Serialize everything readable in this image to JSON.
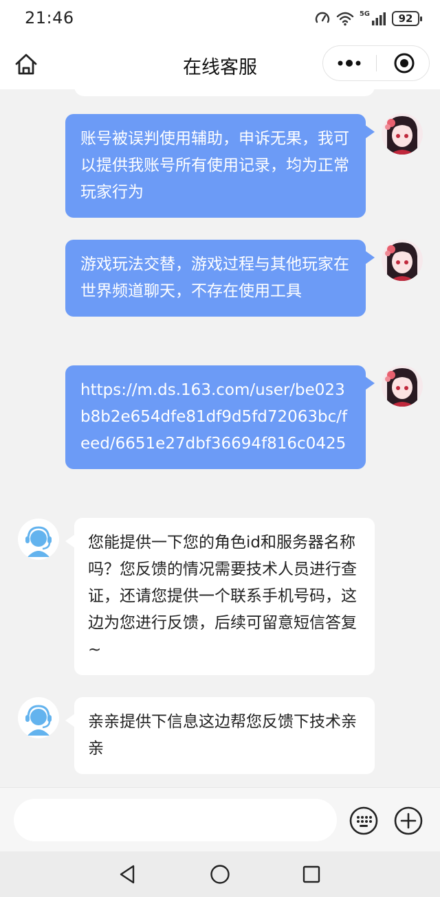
{
  "status_bar": {
    "time": "21:46",
    "network": "5G",
    "battery": "92",
    "icons": [
      "data-speed-icon",
      "wifi-icon",
      "signal-icon",
      "battery-icon"
    ]
  },
  "header": {
    "title": "在线客服",
    "icons": [
      "home-icon",
      "more-dots-icon",
      "close-target-icon"
    ]
  },
  "messages": [
    {
      "sender": "user",
      "text": "账号被误判使用辅助，申诉无果，我可以提供我账号所有使用记录，均为正常玩家行为"
    },
    {
      "sender": "user",
      "text": "游戏玩法交替，游戏过程与其他玩家在世界频道聊天，不存在使用工具"
    },
    {
      "sender": "user",
      "text": "https://m.ds.163.com/user/be023b8b2e654dfe81df9d5fd72063bc/feed/6651e27dbf36694f816c0425"
    },
    {
      "sender": "agent",
      "text": "您能提供一下您的角色id和服务器名称吗？您反馈的情况需要技术人员进行查证，还请您提供一个联系手机号码，这边为您进行反馈，后续可留意短信答复~"
    },
    {
      "sender": "agent",
      "text": "亲亲提供下信息这边帮您反馈下技术亲亲"
    }
  ],
  "input_bar": {
    "value": "",
    "placeholder": "",
    "icons": [
      "keyboard-icon",
      "plus-icon"
    ]
  },
  "nav_bar": {
    "icons": [
      "back-triangle-icon",
      "home-circle-icon",
      "recent-square-icon"
    ]
  },
  "colors": {
    "user_bubble": "#6c9bf6",
    "agent_bubble": "#ffffff",
    "chat_background": "#f2f2f2",
    "agent_icon_blue": "#63b3ee"
  }
}
